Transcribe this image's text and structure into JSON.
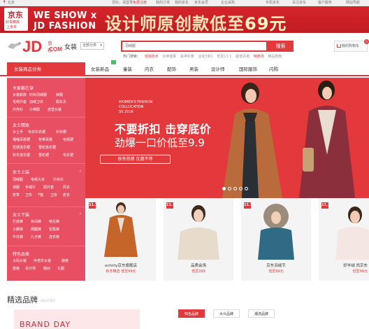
{
  "topbar": {
    "location": "您好，请登录",
    "location_prefix": "北京",
    "login": "您好，请登录",
    "register": "免费注册",
    "links": [
      "我的订单",
      "我的京东",
      "京东会员",
      "企业采购",
      "手机京东",
      "关注京东",
      "客户服务",
      "网站导航"
    ]
  },
  "banner": {
    "logo_line1": "京东",
    "logo_line2": "好货精挑",
    "logo_line3": "上京东",
    "weshow1": "WE SHOW x",
    "weshow2": "JD FASHION",
    "headline": "设计师原创款低至",
    "price": "69元"
  },
  "header": {
    "logo_jd": "JD",
    "logo_dot": "京东",
    "logo_com": ".COM",
    "channel": "女装",
    "allcat": "全部分类",
    "search_value": "羽绒服",
    "search_button": "搜索",
    "hot_label": "热门搜索：",
    "hot_words": [
      "省钱技术",
      "女神盛宴",
      "黑神衣着",
      "运动3免1",
      "低至11.1",
      "超值百搭",
      "特卖场",
      "精品鞋靴"
    ],
    "cart_label": "我的购物车",
    "cart_count": "0"
  },
  "nav": {
    "category_title": "女装商品分类",
    "items": [
      "女装新品",
      "童装",
      "内衣",
      "配饰",
      "男装",
      "设计师",
      "国际服饰",
      "闪购"
    ]
  },
  "sidebar": {
    "sections": [
      {
        "title": "大家都在穿",
        "links": [
          "女装新款",
          "时尚羽绒服",
          "裤服",
          "毛呢外套",
          "加绒卫衣",
          "假东东",
          "外壳衫",
          "小棉服",
          "自营女装"
        ]
      },
      {
        "title": "女士精致",
        "links": [
          "女士半",
          "毛衣衫衣裙",
          "针织裙",
          "嘎嘎百搭裙",
          "背带百搭",
          "毛呢裙",
          "性感连衣裙",
          "雪纺连衣裙",
          "秋冬连衣裙",
          "雪纺裙",
          "毛衣裙"
        ]
      },
      {
        "title": "女士上装",
        "links": [
          "羽绒服",
          "毛呢大衣",
          "针织衫",
          "棉服",
          "手绒衫",
          "短外套",
          "风衣",
          "皮草",
          "卫衣",
          "T恤",
          "卫衣",
          "皮衣"
        ]
      },
      {
        "title": "女士下装",
        "links": [
          "打底裤",
          "休闲裤",
          "哈伦裤",
          "小脚裤",
          "阔腿裤",
          "铅笔裤",
          "牛仔裤",
          "九分裤",
          "连衣裤"
        ]
      },
      {
        "title": "特色品类",
        "links": [
          "大码女装",
          "中老年女装",
          "旗袍",
          "唐装",
          "设计师",
          "婚纱",
          "礼服"
        ]
      }
    ]
  },
  "hero": {
    "title1": "WOMEN'S FASHION",
    "title2": "COLLOCATION",
    "title3": "SS 2016",
    "headline": "不要折扣 击穿底价",
    "subhead": "劲爆一口价低至9.9",
    "pill": "秋冬热销 优惠不停",
    "dots_total": 5,
    "dots_active_index": 0
  },
  "cards": [
    {
      "mark": "11.11",
      "name": "ochirly京东旗舰店",
      "price": "秋冬精选  低至99元"
    },
    {
      "mark": "11.11",
      "name": "品质会场",
      "price": "低至299"
    },
    {
      "mark": "11.11",
      "name": "京东羽绒节",
      "price": "低至99元"
    },
    {
      "mark": "11.11",
      "name": "好羊绒 尚京东",
      "price": "低至99元"
    }
  ],
  "brands": {
    "title": "精选品牌",
    "subtitle": "SELECTED",
    "day_text": "BRAND DAY",
    "tabs": [
      "知名品牌",
      "大众品牌",
      "潮流品牌"
    ],
    "active_tab": 0
  },
  "colors": {
    "accent": "#e4393c",
    "sidebar": "#e84f63"
  }
}
